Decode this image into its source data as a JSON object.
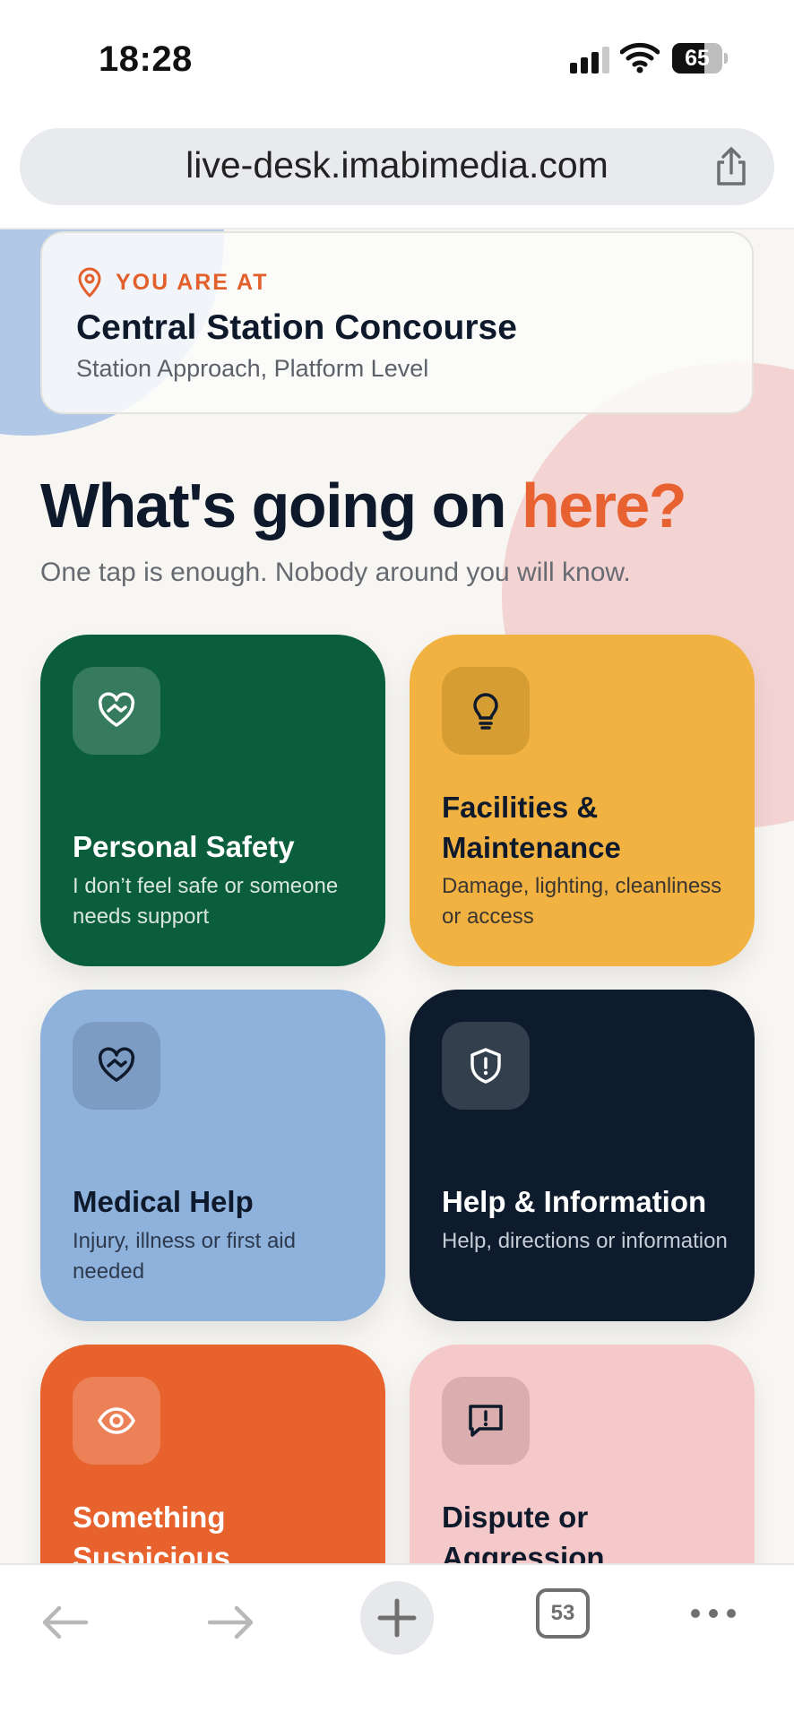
{
  "status_bar": {
    "time": "18:28",
    "battery_level": "65",
    "battery_fraction": 0.65,
    "icons": [
      "cellular-signal-icon",
      "wifi-icon",
      "battery-icon"
    ]
  },
  "browser": {
    "url": "live-desk.imabimedia.com",
    "tab_count": "53",
    "icons": [
      "share-icon",
      "back-arrow-icon",
      "forward-arrow-icon",
      "plus-icon",
      "tabs-icon",
      "more-icon"
    ]
  },
  "location": {
    "tag": "YOU ARE AT",
    "name": "Central Station Concourse",
    "address": "Station Approach, Platform Level",
    "icon": "location-pin-icon"
  },
  "hero": {
    "headline_main": "What's going on ",
    "headline_accent": "here?",
    "subline": "One tap is enough. Nobody around you will know."
  },
  "tiles": [
    {
      "title": "Personal Safety",
      "description": "I don’t feel safe or someone needs support",
      "icon": "heart-handshake-icon",
      "color": "#0b5e3c"
    },
    {
      "title": "Facilities & Maintenance",
      "description": "Damage, lighting, cleanliness or access",
      "icon": "lightbulb-icon",
      "color": "#f1b242"
    },
    {
      "title": "Medical Help",
      "description": "Injury, illness or first aid needed",
      "icon": "heart-handshake-icon",
      "color": "#8fb2dd"
    },
    {
      "title": "Help & Information",
      "description": "Help, directions or information",
      "icon": "shield-alert-icon",
      "color": "#0e1b2c"
    },
    {
      "title": "Something Suspicious",
      "description": "",
      "icon": "eye-icon",
      "color": "#e8622e"
    },
    {
      "title": "Dispute or Aggression",
      "description": "",
      "icon": "message-alert-icon",
      "color": "#f5c8c9"
    }
  ],
  "colors": {
    "accent": "#e86130",
    "background": "#f7f6f2",
    "text_dark": "#0e1a2b"
  }
}
